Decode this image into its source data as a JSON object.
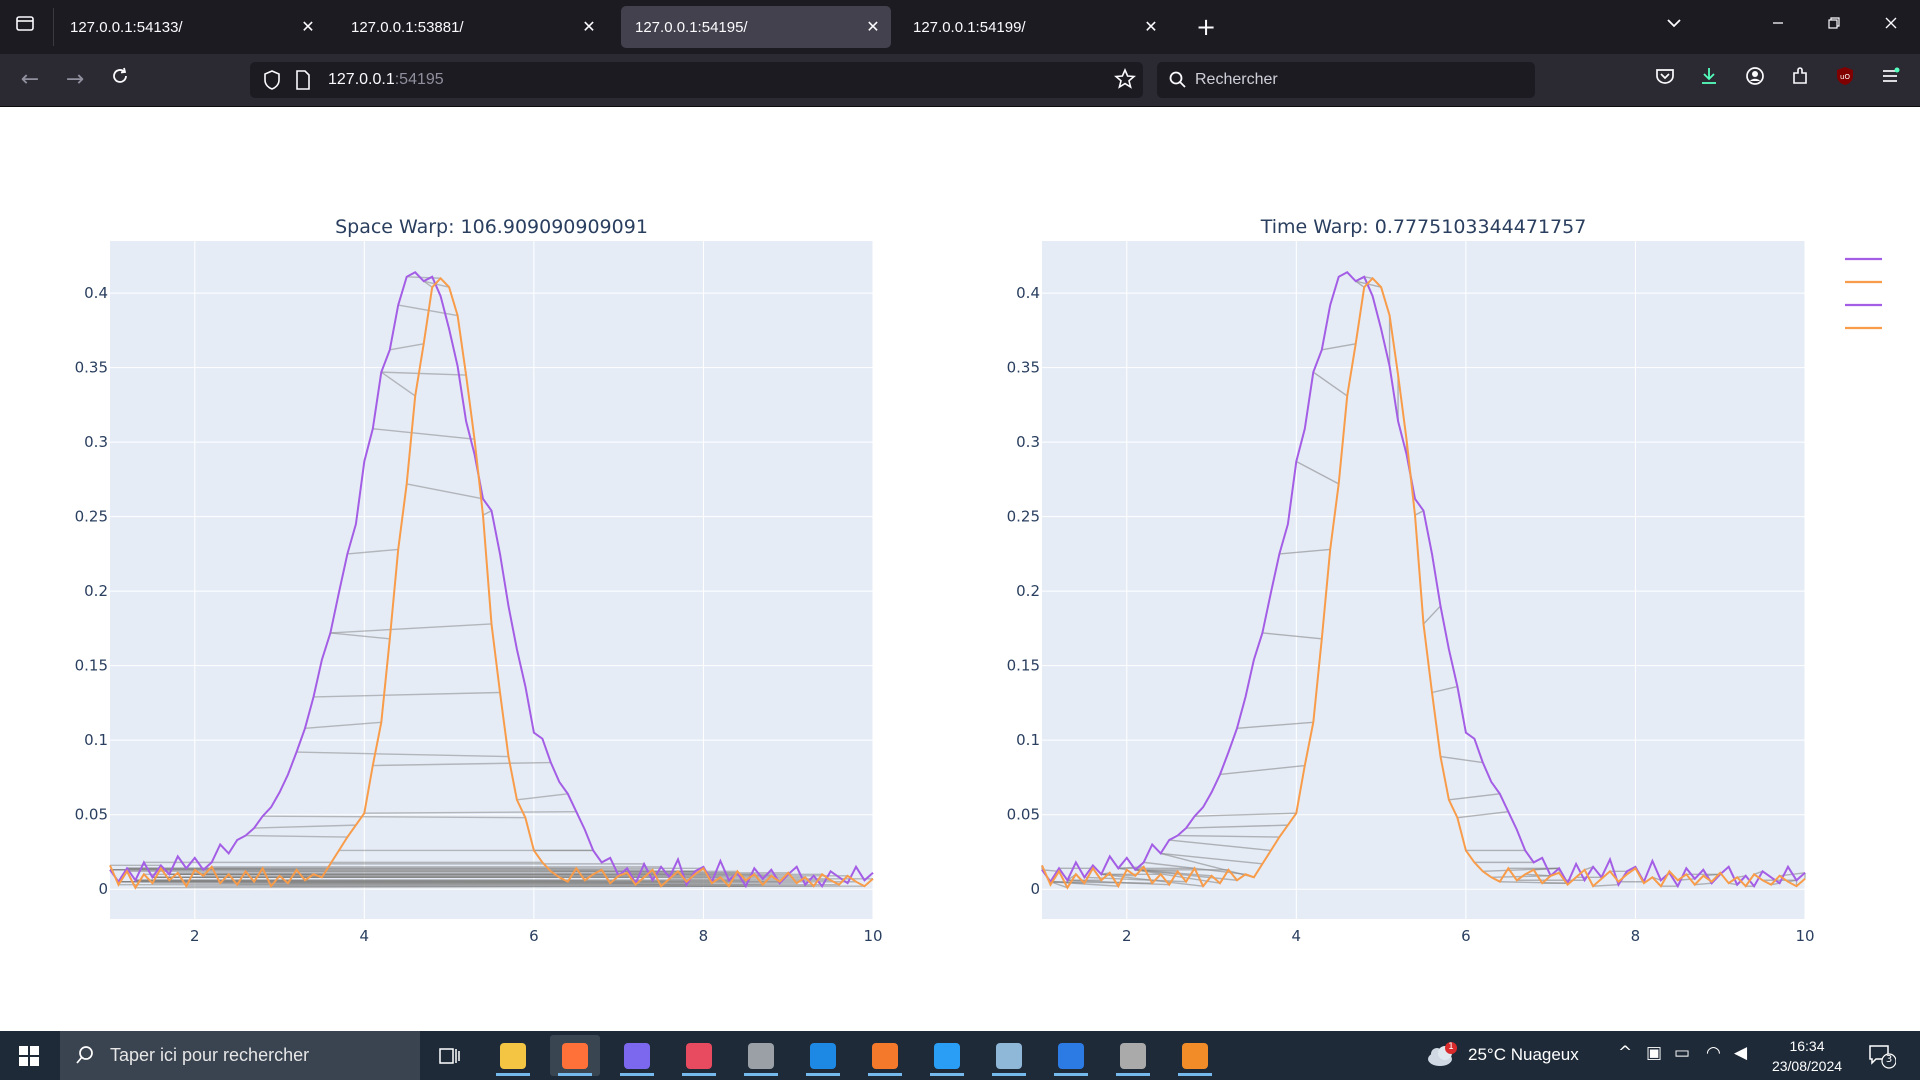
{
  "browser": {
    "tabs": [
      {
        "title": "127.0.0.1:54133/",
        "active": false
      },
      {
        "title": "127.0.0.1:53881/",
        "active": false
      },
      {
        "title": "127.0.0.1:54195/",
        "active": true
      },
      {
        "title": "127.0.0.1:54199/",
        "active": false
      }
    ],
    "url_host": "127.0.0.1",
    "url_port": ":54195",
    "search_placeholder": "Rechercher"
  },
  "chart_data": [
    {
      "type": "line",
      "title": "Space Warp: 106.909090909091",
      "xlim": [
        1,
        10
      ],
      "ylim": [
        -0.02,
        0.435
      ],
      "xticks": [
        2,
        4,
        6,
        8,
        10
      ],
      "yticks": [
        0,
        0.05,
        0.1,
        0.15,
        0.2,
        0.25,
        0.3,
        0.35,
        0.4
      ],
      "ytick_labels": [
        "0",
        "0.05",
        "0.1",
        "0.15",
        "0.2",
        "0.25",
        "0.3",
        "0.35",
        "0.4"
      ],
      "series_colors": [
        "#a45ee5",
        "#f89c4a"
      ],
      "alignment": "space",
      "series": [
        {
          "x": [
            1,
            1.1,
            1.2,
            1.3,
            1.4,
            1.5,
            1.6,
            1.7,
            1.8,
            1.9,
            2,
            2.1,
            2.2,
            2.3,
            2.4,
            2.5,
            2.6,
            2.7,
            2.8,
            2.9,
            3,
            3.1,
            3.2,
            3.3,
            3.4,
            3.5,
            3.6,
            3.7,
            3.8,
            3.9,
            4,
            4.1,
            4.2,
            4.3,
            4.4,
            4.5,
            4.6,
            4.7,
            4.8,
            4.9,
            5,
            5.1,
            5.2,
            5.3,
            5.4,
            5.5,
            5.6,
            5.7,
            5.8,
            5.9,
            6,
            6.1,
            6.2,
            6.3,
            6.4,
            6.5,
            6.6,
            6.7,
            6.8,
            6.9,
            7,
            7.1,
            7.2,
            7.3,
            7.4,
            7.5,
            7.6,
            7.7,
            7.8,
            7.9,
            8,
            8.1,
            8.2,
            8.3,
            8.4,
            8.5,
            8.6,
            8.7,
            8.8,
            8.9,
            9,
            9.1,
            9.2,
            9.3,
            9.4,
            9.5,
            9.6,
            9.7,
            9.8,
            9.9,
            10
          ],
          "y": [
            0.013,
            0.005,
            0.014,
            0.006,
            0.018,
            0.008,
            0.016,
            0.01,
            0.022,
            0.014,
            0.021,
            0.013,
            0.018,
            0.03,
            0.024,
            0.033,
            0.036,
            0.041,
            0.049,
            0.055,
            0.065,
            0.077,
            0.092,
            0.108,
            0.129,
            0.154,
            0.172,
            0.199,
            0.225,
            0.245,
            0.287,
            0.309,
            0.347,
            0.362,
            0.392,
            0.411,
            0.414,
            0.408,
            0.411,
            0.398,
            0.376,
            0.351,
            0.314,
            0.292,
            0.262,
            0.254,
            0.225,
            0.19,
            0.161,
            0.136,
            0.105,
            0.101,
            0.085,
            0.072,
            0.064,
            0.052,
            0.04,
            0.026,
            0.018,
            0.021,
            0.009,
            0.014,
            0.004,
            0.017,
            0.006,
            0.015,
            0.008,
            0.02,
            0.003,
            0.012,
            0.015,
            0.005,
            0.019,
            0.006,
            0.011,
            0.002,
            0.014,
            0.007,
            0.013,
            0.004,
            0.01,
            0.015,
            0.003,
            0.009,
            0.002,
            0.012,
            0.008,
            0.004,
            0.015,
            0.006,
            0.011
          ],
          "color": "#a45ee5"
        },
        {
          "x": [
            1,
            1.1,
            1.2,
            1.3,
            1.4,
            1.5,
            1.6,
            1.7,
            1.8,
            1.9,
            2,
            2.1,
            2.2,
            2.3,
            2.4,
            2.5,
            2.6,
            2.7,
            2.8,
            2.9,
            3,
            3.1,
            3.2,
            3.3,
            3.4,
            3.5,
            3.6,
            3.7,
            3.8,
            3.9,
            4,
            4.1,
            4.2,
            4.3,
            4.4,
            4.5,
            4.6,
            4.7,
            4.8,
            4.9,
            5,
            5.1,
            5.2,
            5.3,
            5.4,
            5.5,
            5.6,
            5.7,
            5.8,
            5.9,
            6,
            6.1,
            6.2,
            6.3,
            6.4,
            6.5,
            6.6,
            6.7,
            6.8,
            6.9,
            7,
            7.1,
            7.2,
            7.3,
            7.4,
            7.5,
            7.6,
            7.7,
            7.8,
            7.9,
            8,
            8.1,
            8.2,
            8.3,
            8.4,
            8.5,
            8.6,
            8.7,
            8.8,
            8.9,
            9,
            9.1,
            9.2,
            9.3,
            9.4,
            9.5,
            9.6,
            9.7,
            9.8,
            9.9,
            10
          ],
          "y": [
            0.016,
            0.003,
            0.012,
            0.001,
            0.01,
            0.004,
            0.014,
            0.006,
            0.011,
            0.002,
            0.013,
            0.009,
            0.015,
            0.004,
            0.01,
            0.003,
            0.012,
            0.005,
            0.014,
            0.002,
            0.009,
            0.004,
            0.013,
            0.006,
            0.01,
            0.008,
            0.017,
            0.026,
            0.035,
            0.043,
            0.051,
            0.083,
            0.112,
            0.168,
            0.228,
            0.272,
            0.331,
            0.366,
            0.404,
            0.41,
            0.404,
            0.385,
            0.345,
            0.302,
            0.251,
            0.178,
            0.132,
            0.089,
            0.06,
            0.048,
            0.026,
            0.018,
            0.012,
            0.008,
            0.005,
            0.014,
            0.006,
            0.01,
            0.013,
            0.004,
            0.009,
            0.011,
            0.003,
            0.008,
            0.013,
            0.002,
            0.007,
            0.012,
            0.005,
            0.01,
            0.014,
            0.004,
            0.008,
            0.002,
            0.012,
            0.006,
            0.01,
            0.003,
            0.009,
            0.005,
            0.011,
            0.004,
            0.008,
            0.002,
            0.01,
            0.006,
            0.003,
            0.009,
            0.005,
            0.002,
            0.007
          ],
          "color": "#f89c4a"
        }
      ]
    },
    {
      "type": "line",
      "title": "Time Warp: 0.7775103344471757",
      "xlim": [
        1,
        10
      ],
      "ylim": [
        -0.02,
        0.435
      ],
      "xticks": [
        2,
        4,
        6,
        8,
        10
      ],
      "yticks": [
        0,
        0.05,
        0.1,
        0.15,
        0.2,
        0.25,
        0.3,
        0.35,
        0.4
      ],
      "ytick_labels": [
        "0",
        "0.05",
        "0.1",
        "0.15",
        "0.2",
        "0.25",
        "0.3",
        "0.35",
        "0.4"
      ],
      "series_colors": [
        "#a45ee5",
        "#f89c4a"
      ],
      "alignment": "time",
      "series": [
        {
          "x": [
            1,
            1.1,
            1.2,
            1.3,
            1.4,
            1.5,
            1.6,
            1.7,
            1.8,
            1.9,
            2,
            2.1,
            2.2,
            2.3,
            2.4,
            2.5,
            2.6,
            2.7,
            2.8,
            2.9,
            3,
            3.1,
            3.2,
            3.3,
            3.4,
            3.5,
            3.6,
            3.7,
            3.8,
            3.9,
            4,
            4.1,
            4.2,
            4.3,
            4.4,
            4.5,
            4.6,
            4.7,
            4.8,
            4.9,
            5,
            5.1,
            5.2,
            5.3,
            5.4,
            5.5,
            5.6,
            5.7,
            5.8,
            5.9,
            6,
            6.1,
            6.2,
            6.3,
            6.4,
            6.5,
            6.6,
            6.7,
            6.8,
            6.9,
            7,
            7.1,
            7.2,
            7.3,
            7.4,
            7.5,
            7.6,
            7.7,
            7.8,
            7.9,
            8,
            8.1,
            8.2,
            8.3,
            8.4,
            8.5,
            8.6,
            8.7,
            8.8,
            8.9,
            9,
            9.1,
            9.2,
            9.3,
            9.4,
            9.5,
            9.6,
            9.7,
            9.8,
            9.9,
            10
          ],
          "y": [
            0.013,
            0.005,
            0.014,
            0.006,
            0.018,
            0.008,
            0.016,
            0.01,
            0.022,
            0.014,
            0.021,
            0.013,
            0.018,
            0.03,
            0.024,
            0.033,
            0.036,
            0.041,
            0.049,
            0.055,
            0.065,
            0.077,
            0.092,
            0.108,
            0.129,
            0.154,
            0.172,
            0.199,
            0.225,
            0.245,
            0.287,
            0.309,
            0.347,
            0.362,
            0.392,
            0.411,
            0.414,
            0.408,
            0.411,
            0.398,
            0.376,
            0.351,
            0.314,
            0.292,
            0.262,
            0.254,
            0.225,
            0.19,
            0.161,
            0.136,
            0.105,
            0.101,
            0.085,
            0.072,
            0.064,
            0.052,
            0.04,
            0.026,
            0.018,
            0.021,
            0.009,
            0.014,
            0.004,
            0.017,
            0.006,
            0.015,
            0.008,
            0.02,
            0.003,
            0.012,
            0.015,
            0.005,
            0.019,
            0.006,
            0.011,
            0.002,
            0.014,
            0.007,
            0.013,
            0.004,
            0.01,
            0.015,
            0.003,
            0.009,
            0.002,
            0.012,
            0.008,
            0.004,
            0.015,
            0.006,
            0.011
          ],
          "color": "#a45ee5"
        },
        {
          "x": [
            1,
            1.1,
            1.2,
            1.3,
            1.4,
            1.5,
            1.6,
            1.7,
            1.8,
            1.9,
            2,
            2.1,
            2.2,
            2.3,
            2.4,
            2.5,
            2.6,
            2.7,
            2.8,
            2.9,
            3,
            3.1,
            3.2,
            3.3,
            3.4,
            3.5,
            3.6,
            3.7,
            3.8,
            3.9,
            4,
            4.1,
            4.2,
            4.3,
            4.4,
            4.5,
            4.6,
            4.7,
            4.8,
            4.9,
            5,
            5.1,
            5.2,
            5.3,
            5.4,
            5.5,
            5.6,
            5.7,
            5.8,
            5.9,
            6,
            6.1,
            6.2,
            6.3,
            6.4,
            6.5,
            6.6,
            6.7,
            6.8,
            6.9,
            7,
            7.1,
            7.2,
            7.3,
            7.4,
            7.5,
            7.6,
            7.7,
            7.8,
            7.9,
            8,
            8.1,
            8.2,
            8.3,
            8.4,
            8.5,
            8.6,
            8.7,
            8.8,
            8.9,
            9,
            9.1,
            9.2,
            9.3,
            9.4,
            9.5,
            9.6,
            9.7,
            9.8,
            9.9,
            10
          ],
          "y": [
            0.016,
            0.003,
            0.012,
            0.001,
            0.01,
            0.004,
            0.014,
            0.006,
            0.011,
            0.002,
            0.013,
            0.009,
            0.015,
            0.004,
            0.01,
            0.003,
            0.012,
            0.005,
            0.014,
            0.002,
            0.009,
            0.004,
            0.013,
            0.006,
            0.01,
            0.008,
            0.017,
            0.026,
            0.035,
            0.043,
            0.051,
            0.083,
            0.112,
            0.168,
            0.228,
            0.272,
            0.331,
            0.366,
            0.404,
            0.41,
            0.404,
            0.385,
            0.345,
            0.302,
            0.251,
            0.178,
            0.132,
            0.089,
            0.06,
            0.048,
            0.026,
            0.018,
            0.012,
            0.008,
            0.005,
            0.014,
            0.006,
            0.01,
            0.013,
            0.004,
            0.009,
            0.011,
            0.003,
            0.008,
            0.013,
            0.002,
            0.007,
            0.012,
            0.005,
            0.01,
            0.014,
            0.004,
            0.008,
            0.002,
            0.012,
            0.006,
            0.01,
            0.003,
            0.009,
            0.005,
            0.011,
            0.004,
            0.008,
            0.002,
            0.01,
            0.006,
            0.003,
            0.009,
            0.005,
            0.002,
            0.007
          ],
          "color": "#f89c4a"
        }
      ]
    }
  ],
  "legend": {
    "entries": [
      {
        "color": "#a45ee5"
      },
      {
        "color": "#f89c4a"
      },
      {
        "color": "#a45ee5"
      },
      {
        "color": "#f89c4a"
      }
    ]
  },
  "taskbar": {
    "search_placeholder": "Taper ici pour rechercher",
    "weather": "25°C  Nuageux",
    "time": "16:34",
    "date": "23/08/2024",
    "notification_count": "3",
    "weather_badge": "1",
    "apps": [
      {
        "name": "file-explorer",
        "color": "#f4c542",
        "active": false
      },
      {
        "name": "firefox",
        "color": "#ff7139",
        "active": true
      },
      {
        "name": "color-app",
        "color": "#7b68ee",
        "active": false
      },
      {
        "name": "paint-app",
        "color": "#e84a5f",
        "active": false
      },
      {
        "name": "k-app",
        "color": "#9aa0a6",
        "active": false
      },
      {
        "name": "m-app",
        "color": "#1e88e5",
        "active": false
      },
      {
        "name": "blender",
        "color": "#f5792a",
        "active": false
      },
      {
        "name": "vscode",
        "color": "#2a9df4",
        "active": false
      },
      {
        "name": "box-app",
        "color": "#8fb8d8",
        "active": false
      },
      {
        "name": "writer",
        "color": "#2c7be5",
        "active": false
      },
      {
        "name": "gimp",
        "color": "#aaaaaa",
        "active": false
      },
      {
        "name": "pdf-app",
        "color": "#f28c28",
        "active": false
      }
    ]
  }
}
